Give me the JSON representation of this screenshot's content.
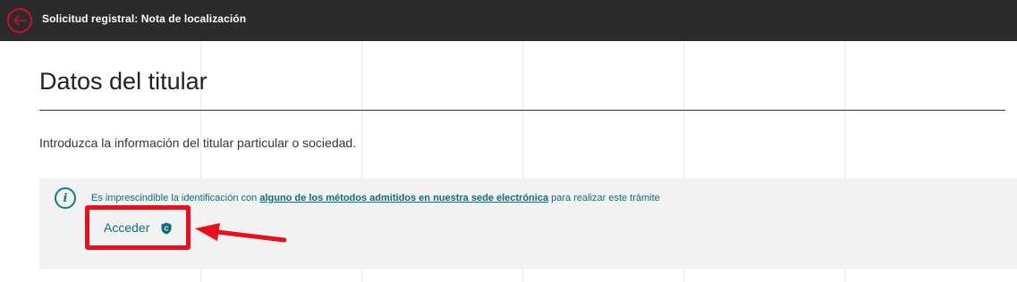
{
  "topbar": {
    "title": "Solicitud registral: Nota de localización"
  },
  "main": {
    "heading": "Datos del titular",
    "intro": "Introduzca la información del titular particular o sociedad."
  },
  "info": {
    "text_before": "Es imprescindible la identificación con ",
    "link_text": "alguno de los métodos admitidos en nuestra sede electrónica",
    "text_after": " para realizar este trámite",
    "icon_letter": "i"
  },
  "login": {
    "label": "Acceder",
    "badge_letter": "C"
  },
  "colors": {
    "topbar_bg": "#2b2b2b",
    "accent_red": "#c8102e",
    "teal": "#0d6d7a",
    "annotation_red": "#e8101c"
  }
}
